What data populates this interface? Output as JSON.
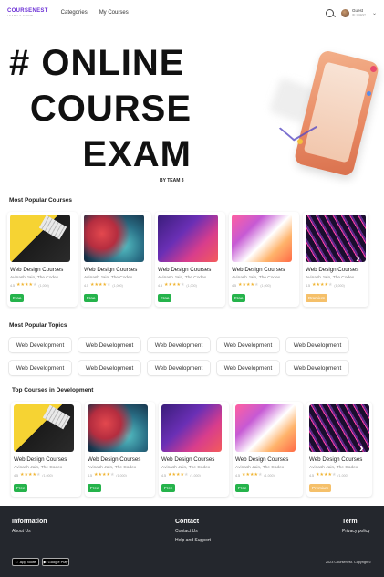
{
  "header": {
    "logo_top": "COURSENEST",
    "logo_bottom": "LEARN & GROW",
    "nav": [
      "Categories",
      "My Courses"
    ],
    "user_name": "Guest",
    "user_sub": "ID: GUEST"
  },
  "hero": {
    "line1": "# ONLINE",
    "line2": "COURSE",
    "line3": "EXAM",
    "byline": "BY TEAM 3"
  },
  "popular_courses": {
    "title": "Most Popular Courses",
    "cards": [
      {
        "title": "Web Design Courses",
        "author": "Avinash Jain, The Codex",
        "rating": "4.5",
        "count": "(1,000)",
        "badge": "Free"
      },
      {
        "title": "Web Design Courses",
        "author": "Avinash Jain, The Codex",
        "rating": "4.5",
        "count": "(1,000)",
        "badge": "Free"
      },
      {
        "title": "Web Design Courses",
        "author": "Avinash Jain, The Codex",
        "rating": "4.5",
        "count": "(1,000)",
        "badge": "Free"
      },
      {
        "title": "Web Design Courses",
        "author": "Avinash Jain, The Codex",
        "rating": "4.5",
        "count": "(1,000)",
        "badge": "Free"
      },
      {
        "title": "Web Design Courses",
        "author": "Avinash Jain, The Codex",
        "rating": "4.5",
        "count": "(1,000)",
        "badge": "Premium"
      }
    ]
  },
  "popular_topics": {
    "title": "Most Popular Topics",
    "chips": [
      "Web Development",
      "Web Development",
      "Web Development",
      "Web Development",
      "Web Development",
      "Web Development",
      "Web Development",
      "Web Development",
      "Web Development",
      "Web Development"
    ]
  },
  "top_courses": {
    "title": "Top Courses in Development",
    "cards": [
      {
        "title": "Web Design Courses",
        "author": "Avinash Jain, The Codex",
        "rating": "4.5",
        "count": "(1,000)",
        "badge": "Free"
      },
      {
        "title": "Web Design Courses",
        "author": "Avinash Jain, The Codex",
        "rating": "4.5",
        "count": "(1,000)",
        "badge": "Free"
      },
      {
        "title": "Web Design Courses",
        "author": "Avinash Jain, The Codex",
        "rating": "4.5",
        "count": "(1,000)",
        "badge": "Free"
      },
      {
        "title": "Web Design Courses",
        "author": "Avinash Jain, The Codex",
        "rating": "4.5",
        "count": "(1,000)",
        "badge": "Free"
      },
      {
        "title": "Web Design Courses",
        "author": "Avinash Jain, The Codex",
        "rating": "4.5",
        "count": "(1,000)",
        "badge": "Premium"
      }
    ]
  },
  "footer": {
    "information": {
      "heading": "Information",
      "links": [
        "About Us"
      ]
    },
    "contact": {
      "heading": "Contact",
      "links": [
        "Contact Us",
        "Help and Support"
      ]
    },
    "term": {
      "heading": "Term",
      "links": [
        "Privacy policy"
      ]
    },
    "app_store": "App Store",
    "google_play": "Google Play",
    "copyright": "2023 Coursenest. Copyright©"
  },
  "colors": {
    "accent": "#6b2fd6",
    "free": "#25b34b",
    "premium": "#f5c06a",
    "footer_bg": "#24272d"
  }
}
